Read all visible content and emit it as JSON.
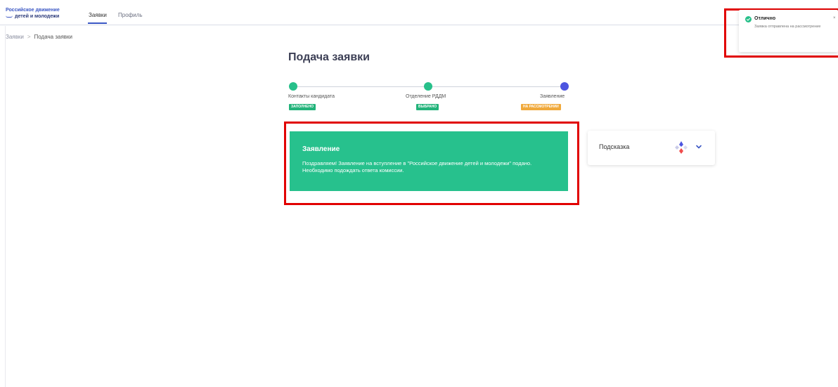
{
  "header": {
    "logo_line1": "Российское движение",
    "logo_line2": "детей и молодежи",
    "tabs": [
      {
        "label": "Заявки",
        "active": true
      },
      {
        "label": "Профиль",
        "active": false
      }
    ]
  },
  "breadcrumb": {
    "items": [
      "Заявки",
      "Подача заявки"
    ],
    "separator": ">"
  },
  "page": {
    "title": "Подача заявки"
  },
  "stepper": {
    "steps": [
      {
        "label": "Контакты кандидата",
        "status": "ЗАПОЛНЕНО",
        "dot_color": "#27c08a",
        "badge_color": "#22b37a"
      },
      {
        "label": "Отделение РДДМ",
        "status": "ВЫБРАНО",
        "dot_color": "#27c08a",
        "badge_color": "#22b37a"
      },
      {
        "label": "Заявление",
        "status": "НА РАССМОТРЕНИИ",
        "dot_color": "#4d55e0",
        "badge_color": "#f0a93b"
      }
    ]
  },
  "statement_card": {
    "title": "Заявление",
    "text": "Поздравляем! Заявление на вступление в \"Российское движение детей и молодежи\" подано. Необходимо подождать ответа комиссии.",
    "bg_color": "#27c18d"
  },
  "hint": {
    "label": "Подсказка",
    "icon": "diamond-dots-icon",
    "expand_icon": "chevron-down-icon"
  },
  "toast": {
    "title": "Отлично",
    "message": "Заявка отправлена на рассмотрение",
    "icon": "check-circle-icon",
    "close": "×"
  },
  "colors": {
    "accent": "#3b57c4",
    "success": "#27c18d",
    "warning": "#f0a93b",
    "highlight": "#e10000"
  }
}
